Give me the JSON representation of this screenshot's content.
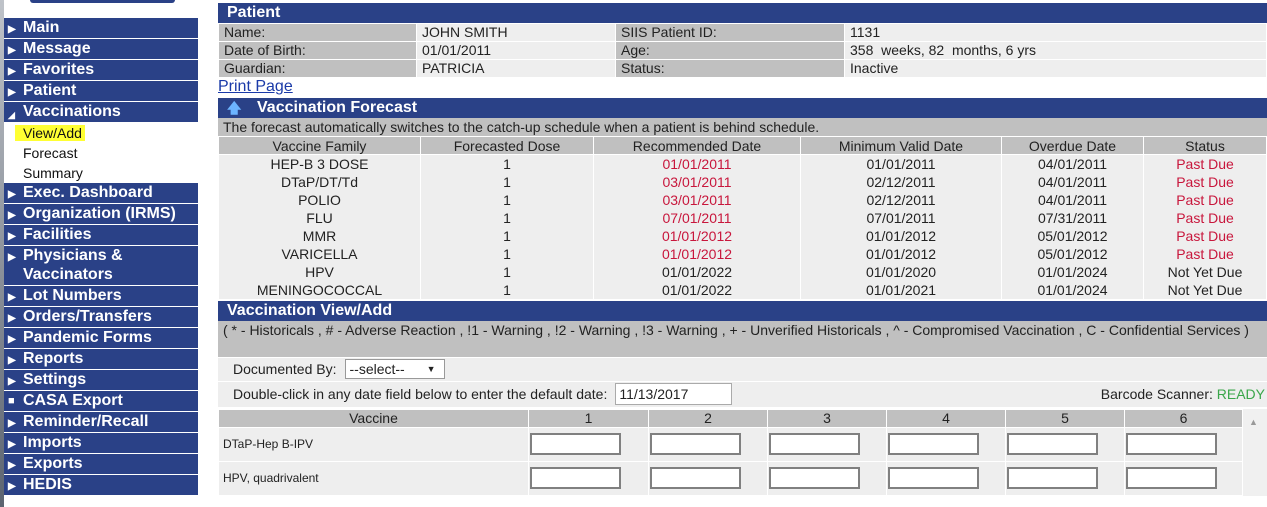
{
  "sidebar": {
    "items": [
      {
        "label": "Main",
        "icon": "triangle-right"
      },
      {
        "label": "Message",
        "icon": "triangle-right"
      },
      {
        "label": "Favorites",
        "icon": "triangle-right"
      },
      {
        "label": "Patient",
        "icon": "triangle-right"
      },
      {
        "label": "Vaccinations",
        "icon": "triangle-down",
        "expanded": true,
        "children": [
          {
            "label": "View/Add",
            "selected": true
          },
          {
            "label": "Forecast"
          },
          {
            "label": "Summary"
          }
        ]
      },
      {
        "label": "Exec. Dashboard",
        "icon": "triangle-right"
      },
      {
        "label": "Organization (IRMS)",
        "icon": "triangle-right"
      },
      {
        "label": "Facilities",
        "icon": "triangle-right"
      },
      {
        "label": "Physicians & Vaccinators",
        "icon": "triangle-right"
      },
      {
        "label": "Lot Numbers",
        "icon": "triangle-right"
      },
      {
        "label": "Orders/Transfers",
        "icon": "triangle-right"
      },
      {
        "label": "Pandemic Forms",
        "icon": "triangle-right"
      },
      {
        "label": "Reports",
        "icon": "triangle-right"
      },
      {
        "label": "Settings",
        "icon": "triangle-right"
      },
      {
        "label": "CASA Export",
        "icon": "square"
      },
      {
        "label": "Reminder/Recall",
        "icon": "triangle-right"
      },
      {
        "label": "Imports",
        "icon": "triangle-right"
      },
      {
        "label": "Exports",
        "icon": "triangle-right"
      },
      {
        "label": "HEDIS",
        "icon": "triangle-right"
      }
    ],
    "highlight_color": "#ffff33"
  },
  "patient": {
    "title": "Patient",
    "name_label": "Name:",
    "name": "JOHN SMITH",
    "dob_label": "Date of Birth:",
    "dob": "01/01/2011",
    "guardian_label": "Guardian:",
    "guardian": "PATRICIA",
    "id_label": "SIIS Patient ID:",
    "id": "1131",
    "age_label": "Age:",
    "age": "358  weeks, 82  months, 6 yrs",
    "status_label": "Status:",
    "status": "Inactive"
  },
  "print_link": "Print Page",
  "forecast": {
    "title": "Vaccination Forecast",
    "note": "The forecast automatically switches to the catch-up schedule when a patient is behind schedule.",
    "columns": [
      "Vaccine Family",
      "Forecasted Dose",
      "Recommended Date",
      "Minimum Valid Date",
      "Overdue Date",
      "Status"
    ],
    "rows": [
      {
        "family": "HEP-B 3 DOSE",
        "dose": "1",
        "recommended": "01/01/2011",
        "min_valid": "01/01/2011",
        "overdue": "04/01/2011",
        "status": "Past Due",
        "past_due": true
      },
      {
        "family": "DTaP/DT/Td",
        "dose": "1",
        "recommended": "03/01/2011",
        "min_valid": "02/12/2011",
        "overdue": "04/01/2011",
        "status": "Past Due",
        "past_due": true
      },
      {
        "family": "POLIO",
        "dose": "1",
        "recommended": "03/01/2011",
        "min_valid": "02/12/2011",
        "overdue": "04/01/2011",
        "status": "Past Due",
        "past_due": true
      },
      {
        "family": "FLU",
        "dose": "1",
        "recommended": "07/01/2011",
        "min_valid": "07/01/2011",
        "overdue": "07/31/2011",
        "status": "Past Due",
        "past_due": true
      },
      {
        "family": "MMR",
        "dose": "1",
        "recommended": "01/01/2012",
        "min_valid": "01/01/2012",
        "overdue": "05/01/2012",
        "status": "Past Due",
        "past_due": true
      },
      {
        "family": "VARICELLA",
        "dose": "1",
        "recommended": "01/01/2012",
        "min_valid": "01/01/2012",
        "overdue": "05/01/2012",
        "status": "Past Due",
        "past_due": true
      },
      {
        "family": "HPV",
        "dose": "1",
        "recommended": "01/01/2022",
        "min_valid": "01/01/2020",
        "overdue": "01/01/2024",
        "status": "Not Yet Due",
        "past_due": false
      },
      {
        "family": "MENINGOCOCCAL",
        "dose": "1",
        "recommended": "01/01/2022",
        "min_valid": "01/01/2021",
        "overdue": "01/01/2024",
        "status": "Not Yet Due",
        "past_due": false
      }
    ],
    "past_due_color": "#c8163c"
  },
  "view_add": {
    "title": "Vaccination View/Add",
    "legend": "( * - Historicals , # - Adverse Reaction , !1 - Warning , !2 - Warning , !3 - Warning , + - Unverified Historicals , ^ - Compromised Vaccination , C - Confidential Services )",
    "documented_by_label": "Documented By:",
    "documented_by_value": "--select--",
    "default_date_label": "Double-click in any date field below to enter the default date:",
    "default_date_value": "11/13/2017",
    "scanner_label": "Barcode Scanner:",
    "scanner_status": "READY",
    "scanner_status_color": "#3aa64a",
    "columns": [
      "Vaccine",
      "1",
      "2",
      "3",
      "4",
      "5",
      "6"
    ],
    "rows": [
      {
        "vaccine": "DTaP-Hep B-IPV"
      },
      {
        "vaccine": "HPV, quadrivalent"
      }
    ]
  },
  "colors": {
    "nav_bg": "#2a4187",
    "label_bg": "#c0c0c0",
    "value_bg": "#eeeeee"
  }
}
